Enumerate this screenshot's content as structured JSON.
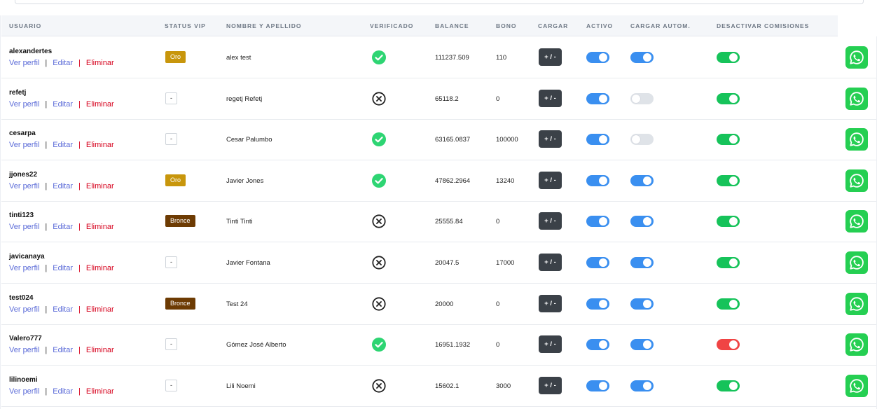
{
  "colors": {
    "toggle_blue": "#3a8ff0",
    "toggle_off": "#dfe3e8",
    "toggle_green": "#16c35a",
    "toggle_red": "#f04444",
    "vip_oro": "#c8960c",
    "vip_bronce": "#6d3b03",
    "verified_green": "#2ed573",
    "whatsapp": "#25cf52"
  },
  "headers": {
    "usuario": "USUARIO",
    "status_vip": "STATUS VIP",
    "nombre": "NOMBRE Y APELLIDO",
    "verificado": "VERIFICADO",
    "balance": "BALANCE",
    "bono": "BONO",
    "cargar": "CARGAR",
    "activo": "ACTIVO",
    "cargar_autom": "CARGAR AUTOM.",
    "desactivar": "DESACTIVAR COMISIONES"
  },
  "actions": {
    "ver_perfil": "Ver perfil",
    "editar": "Editar",
    "eliminar": "Eliminar",
    "sep": "|"
  },
  "cargar_label": "+ / -",
  "rows": [
    {
      "usuario": "alexandertes",
      "vip": "Oro",
      "nombre": "alex test",
      "verificado": true,
      "balance": "111237.509",
      "bono": "110",
      "activo": true,
      "cargar_autom": true,
      "desactivar": "on"
    },
    {
      "usuario": "refetj",
      "vip": "-",
      "nombre": "regetj Refetj",
      "verificado": false,
      "balance": "65118.2",
      "bono": "0",
      "activo": true,
      "cargar_autom": false,
      "desactivar": "on"
    },
    {
      "usuario": "cesarpa",
      "vip": "-",
      "nombre": "Cesar Palumbo",
      "verificado": true,
      "balance": "63165.0837",
      "bono": "100000",
      "activo": true,
      "cargar_autom": false,
      "desactivar": "on"
    },
    {
      "usuario": "jjones22",
      "vip": "Oro",
      "nombre": "Javier Jones",
      "verificado": true,
      "balance": "47862.2964",
      "bono": "13240",
      "activo": true,
      "cargar_autom": true,
      "desactivar": "on"
    },
    {
      "usuario": "tinti123",
      "vip": "Bronce",
      "nombre": "Tinti Tinti",
      "verificado": false,
      "balance": "25555.84",
      "bono": "0",
      "activo": true,
      "cargar_autom": true,
      "desactivar": "on"
    },
    {
      "usuario": "javicanaya",
      "vip": "-",
      "nombre": "Javier Fontana",
      "verificado": false,
      "balance": "20047.5",
      "bono": "17000",
      "activo": true,
      "cargar_autom": true,
      "desactivar": "on"
    },
    {
      "usuario": "test024",
      "vip": "Bronce",
      "nombre": "Test 24",
      "verificado": false,
      "balance": "20000",
      "bono": "0",
      "activo": true,
      "cargar_autom": true,
      "desactivar": "on"
    },
    {
      "usuario": "Valero777",
      "vip": "-",
      "nombre": "Gómez José Alberto",
      "verificado": true,
      "balance": "16951.1932",
      "bono": "0",
      "activo": true,
      "cargar_autom": true,
      "desactivar": "red"
    },
    {
      "usuario": "lilinoemi",
      "vip": "-",
      "nombre": "Lili Noemi",
      "verificado": false,
      "balance": "15602.1",
      "bono": "3000",
      "activo": true,
      "cargar_autom": true,
      "desactivar": "on"
    }
  ]
}
